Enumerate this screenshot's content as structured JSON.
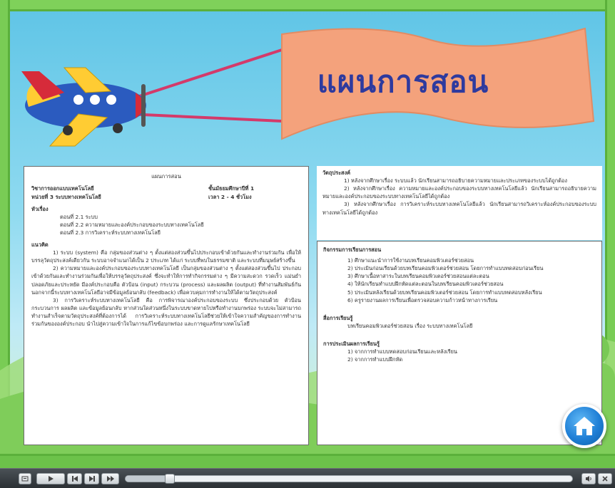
{
  "banner": {
    "title": "แผนการสอน"
  },
  "lesson_plan": {
    "title": "แผนการสอน",
    "subject": "วิชาการออกแบบเทคโนโลยี",
    "grade": "ชั้นมัธยมศึกษาปีที่ 1",
    "unit": "หน่วยที่ 3 ระบบทางเทคโนโลยี",
    "time": "เวลา 2 - 4 ชั่วโมง",
    "topics_heading": "หัวเรื่อง",
    "topics": [
      "ตอนที่ 2.1 ระบบ",
      "ตอนที่ 2.2 ความหมายและองค์ประกอบของระบบทางเทคโนโลยี",
      "ตอนที่ 2.3 การวิเคราะห์ระบบทางเทคโนโลยี"
    ],
    "concept_heading": "แนวคิด",
    "concepts": [
      "1) ระบบ (system) คือ กลุ่มของส่วนต่าง ๆ ตั้งแต่สองส่วนขึ้นไปประกอบเข้าด้วยกันและทำงานร่วมกัน เพื่อให้บรรลุวัตถุประสงค์เดียวกัน ระบบอาจจำแนกได้เป็น 2 ประเภท ได้แก่ ระบบที่พบในธรรมชาติ และระบบที่มนุษย์สร้างขึ้น",
      "2) ความหมายและองค์ประกอบของระบบทางเทคโนโลยี เป็นกลุ่มของส่วนต่าง ๆ ตั้งแต่สองส่วนขึ้นไป ประกอบเข้าด้วยกันและทำงานร่วมกันเพื่อให้บรรลุวัตถุประสงค์ ซึ่งจะทำให้การทำกิจกรรมต่าง ๆ มีความสะดวก รวดเร็ว แม่นยำ ปลอดภัยและประหยัด มีองค์ประกอบคือ ตัวป้อน (input) กระบวน (process) และผลผลิต (output) ที่ทำงานสัมพันธ์กัน นอกจากนี้ระบบทางเทคโนโลยีอาจมีข้อมูลย้อนกลับ (feedback) เพื่อควบคุมการทำงานให้ได้ตามวัตถุประสงค์",
      "3) การวิเคราะห์ระบบทางเทคโนโลยี คือ การพิจารณาองค์ประกอบของระบบ ซึ่งประกอบด้วย ตัวป้อน กระบวนการ ผลผลิต และข้อมูลย้อนกลับ หากส่วนใดส่วนหนึ่งในระบบขาดหายไปหรือทำงานบกพร่อง ระบบจะไม่สามารถทำงานสำเร็จตามวัตถุประสงค์ที่ต้องการได้ การวิเคราะห์ระบบทางเทคโนโลยีช่วยให้เข้าใจความสำคัญของการทำงานร่วมกันขององค์ประกอบ นำไปสู่ความเข้าใจในการแก้ไขข้อบกพร่อง และการดูแลรักษาเทคโนโลยี"
    ]
  },
  "objectives": {
    "heading": "วัตถุประสงค์",
    "items": [
      "1) หลังจากศึกษาเรื่อง ระบบแล้ว นักเรียนสามารถอธิบายความหมายและประเภทของระบบได้ถูกต้อง",
      "2) หลังจากศึกษาเรื่อง ความหมายและองค์ประกอบของระบบทางเทคโนโลยีแล้ว นักเรียนสามารถอธิบายความหมายและองค์ประกอบของระบบทางเทคโนโลยีได้ถูกต้อง",
      "3) หลังจากศึกษาเรื่อง การวิเคราะห์ระบบทางเทคโนโลยีแล้ว นักเรียนสามารถวิเคราะห์องค์ประกอบของระบบทางเทคโนโลยีได้ถูกต้อง"
    ]
  },
  "activities": {
    "heading": "กิจกรรมการเรียนการสอน",
    "items": [
      "1) ศึกษาแนะนำการใช้งานบทเรียนคอมพิวเตอร์ช่วยสอน",
      "2) ประเมินก่อนเรียนด้วยบทเรียนคอมพิวเตอร์ช่วยสอน โดยการทำแบบทดสอบก่อนเรียน",
      "3) ศึกษาเนื้อหาสาระในบทเรียนคอมพิวเตอร์ช่วยสอนแต่ละตอน",
      "4) ให้นักเรียนทำแบบฝึกหัดแต่ละตอนในบทเรียนคอมพิวเตอร์ช่วยสอน",
      "5) ประเมินหลังเรียนด้วยบทเรียนคอมพิวเตอร์ช่วยสอน โดยการทำแบบทดสอบหลังเรียน",
      "6) ครูรายงานผลการเรียนเพื่อตรวจสอบความก้าวหน้าทางการเรียน"
    ],
    "media_heading": "สื่อการเรียนรู้",
    "media": "บทเรียนคอมพิวเตอร์ช่วยสอน เรื่อง ระบบทางเทคโนโลยี",
    "evaluation_heading": "การประเมินผลการเรียนรู้",
    "evaluation": [
      "1) จากการทำแบบทดสอบก่อนเรียนและหลังเรียน",
      "2) จากการทำแบบฝึกหัด"
    ]
  },
  "player": {
    "progress": 0.1,
    "colors": {
      "bar": "#2b3034",
      "track": "#eef1f3",
      "accent": "#1f7fd6"
    }
  },
  "icons": [
    "airplane-icon",
    "home-icon",
    "caption-icon",
    "play-icon",
    "pause-icon",
    "rewind-icon",
    "forward-icon",
    "fast-forward-icon",
    "volume-icon",
    "close-icon"
  ]
}
